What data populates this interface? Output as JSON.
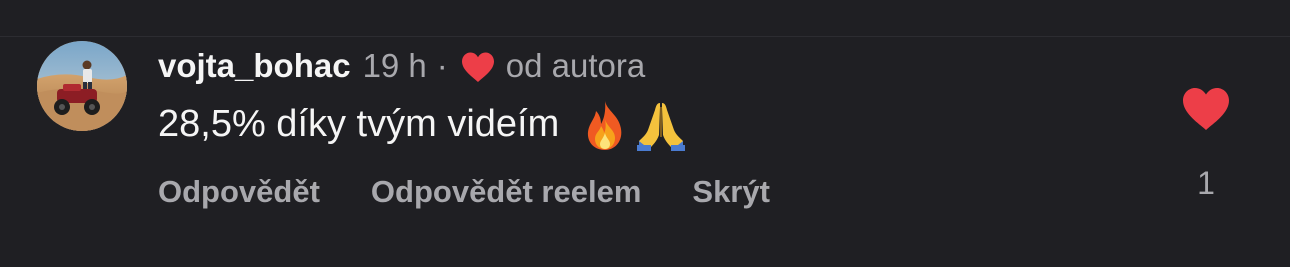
{
  "comment": {
    "username": "vojta_bohac",
    "time": "19 h",
    "separator": "·",
    "liked_by_author_icon": "heart-icon",
    "author_note": "od autora",
    "text": "28,5% díky tvým videím",
    "emojis": [
      "fire-emoji",
      "folded-hands-emoji"
    ],
    "actions": {
      "reply": "Odpovědět",
      "reply_reel": "Odpovědět reelem",
      "hide": "Skrýt"
    },
    "like": {
      "icon": "heart-icon",
      "count": "1",
      "liked": true
    }
  },
  "colors": {
    "background": "#1f1f23",
    "primary_text": "#f5f5f5",
    "secondary_text": "#a8a8ad",
    "heart": "#ed3e48"
  }
}
